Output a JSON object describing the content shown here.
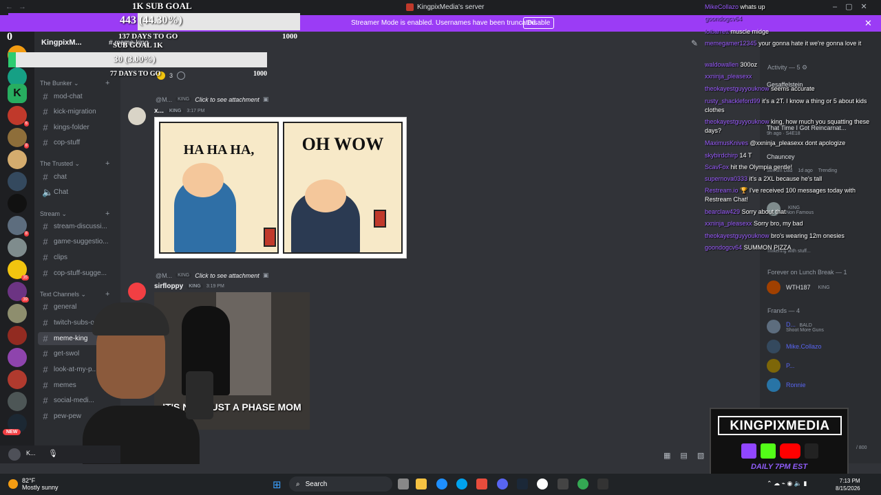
{
  "window": {
    "title": "KingpixMedia's server"
  },
  "streamer_bar": {
    "message": "Streamer Mode is enabled. Usernames have been truncated.",
    "disable_label": "Disable"
  },
  "sub_goal_main": {
    "title": "1K SUB GOAL",
    "current_label": "443 (44.30%)",
    "progress": 0.443,
    "days_label": "137 DAYS TO GO",
    "start": "0",
    "end": "1000"
  },
  "sub_goal_secondary": {
    "title": "SUB GOAL 1K",
    "current_label": "30 (3.00%)",
    "progress": 0.03,
    "days_label": "77 DAYS TO GO",
    "end": "1000"
  },
  "server": {
    "name": "KingpixM...",
    "channel_header": "meme-king",
    "reaction_count": "3"
  },
  "sidebar": {
    "categories": [
      {
        "name": "The Bunker",
        "channels": [
          "mod-chat",
          "kick-migration",
          "kings-folder",
          "cop-stuff"
        ]
      },
      {
        "name": "The Trusted",
        "channels": [
          "chat",
          "Chat"
        ]
      },
      {
        "name": "Stream",
        "channels": [
          "stream-discussi...",
          "game-suggestio...",
          "clips",
          "cop-stuff-sugge..."
        ]
      },
      {
        "name": "Text Channels",
        "channels": [
          "general",
          "twitch-subs-on...",
          "meme-king",
          "get-swol",
          "look-at-my-p...",
          "memes",
          "social-medi...",
          "pew-pew"
        ]
      }
    ],
    "new_badge": "NEW"
  },
  "messages": [
    {
      "reply_name": "@M...",
      "reply_role": "KING",
      "reply_text": "Click to see attachment",
      "author": "x...",
      "role": "KING",
      "time": "3:17 PM",
      "meme_left": "HA HA HA,",
      "meme_right": "OH WOW"
    },
    {
      "reply_name": "@M...",
      "reply_role": "KING",
      "reply_text": "Click to see attachment",
      "author": "sirfloppy",
      "role": "KING",
      "time": "3:19 PM",
      "caption": "IT'S NOT JUST A PHASE MOM"
    }
  ],
  "members": {
    "activity_header": "Activity — 5",
    "activity": [
      {
        "name": "Gesaffelstein",
        "sub": ""
      },
      {
        "name": "That Time I Got Reincarnat...",
        "sub": "9h ago · S4E18"
      },
      {
        "name": "Chauncey",
        "sub": ""
      },
      {
        "name": "Trending",
        "sub": "1d ago"
      },
      {
        "name": "Stream Dad",
        "sub": ""
      },
      {
        "name": "KING",
        "sub": "Non Famous"
      },
      {
        "name": "Tinkering with stuff...",
        "sub": ""
      }
    ],
    "lunch_header": "Forever on Lunch Break — 1",
    "lunch": [
      {
        "name": "WTH187",
        "role": "KING"
      }
    ],
    "frands_header": "Frands — 4",
    "frands": [
      {
        "name": "D...",
        "role": "BALD",
        "sub": "Shoot More Guns"
      },
      {
        "name": "Mike.Collazo",
        "sub": ""
      },
      {
        "name": "P...",
        "sub": ""
      },
      {
        "name": "Ronnie",
        "sub": ""
      }
    ],
    "char_counter": "/ 800"
  },
  "chat": [
    {
      "user": "MikeCollazo",
      "text": "whats up",
      "color": "#9b5cff"
    },
    {
      "user": "goondogcv64",
      "text": "",
      "color": "#9b5cff"
    },
    {
      "user": "lolbarrett",
      "text": "muscle midge",
      "color": "#9b5cff"
    },
    {
      "user": "memegamer12345",
      "text": "your gonna hate it we're gonna love it",
      "color": "#9b5cff"
    },
    {
      "user": "waldowallen",
      "text": "300oz",
      "color": "#9b5cff"
    },
    {
      "user": "xxninja_pleasexx",
      "text": "",
      "color": "#9b5cff"
    },
    {
      "user": "theokayestguyyouknow",
      "text": "seems accurate",
      "color": "#9b5cff"
    },
    {
      "user": "rusty_shackleford99",
      "text": "it's a 2T. I know a thing or 5 about kids clothes",
      "color": "#9b5cff"
    },
    {
      "user": "theokayestguyyouknow",
      "text": "king, how much you squatting these days?",
      "color": "#9b5cff"
    },
    {
      "user": "MaximusKnives",
      "text": "@xxninja_pleasexx dont apologize",
      "color": "#9b5cff"
    },
    {
      "user": "skybirdchirp",
      "text": "14 T",
      "color": "#9b5cff"
    },
    {
      "user": "ScavFox",
      "text": "hit the Olympia gentle!",
      "color": "#9b5cff"
    },
    {
      "user": "supernova0333",
      "text": "it's a 2XL because he's tall",
      "color": "#9b5cff"
    },
    {
      "user": "Restream.io",
      "text": "🏆 I've received 100 messages today with Restream Chat!",
      "color": "#9b5cff"
    },
    {
      "user": "bearclaw429",
      "text": "Sorry about that",
      "color": "#9b5cff"
    },
    {
      "user": "xxninja_pleasexx",
      "text": "Sorry bro, my bad",
      "color": "#9b5cff"
    },
    {
      "user": "theokayestguyyouknow",
      "text": "bro's wearing 12m onesies",
      "color": "#9b5cff"
    },
    {
      "user": "goondogcv64",
      "text": "SUMMON PIZZA",
      "color": "#9b5cff"
    }
  ],
  "brand": {
    "name": "KINGPIXMEDIA",
    "schedule": "DAILY 7PM EST",
    "accent": "#9b3cf5"
  },
  "taskbar": {
    "temp": "82°F",
    "weather": "Mostly sunny",
    "search": "Search",
    "time": "7:13 PM",
    "date": "8/15/2026"
  },
  "user_panel": {
    "name": "K..."
  }
}
